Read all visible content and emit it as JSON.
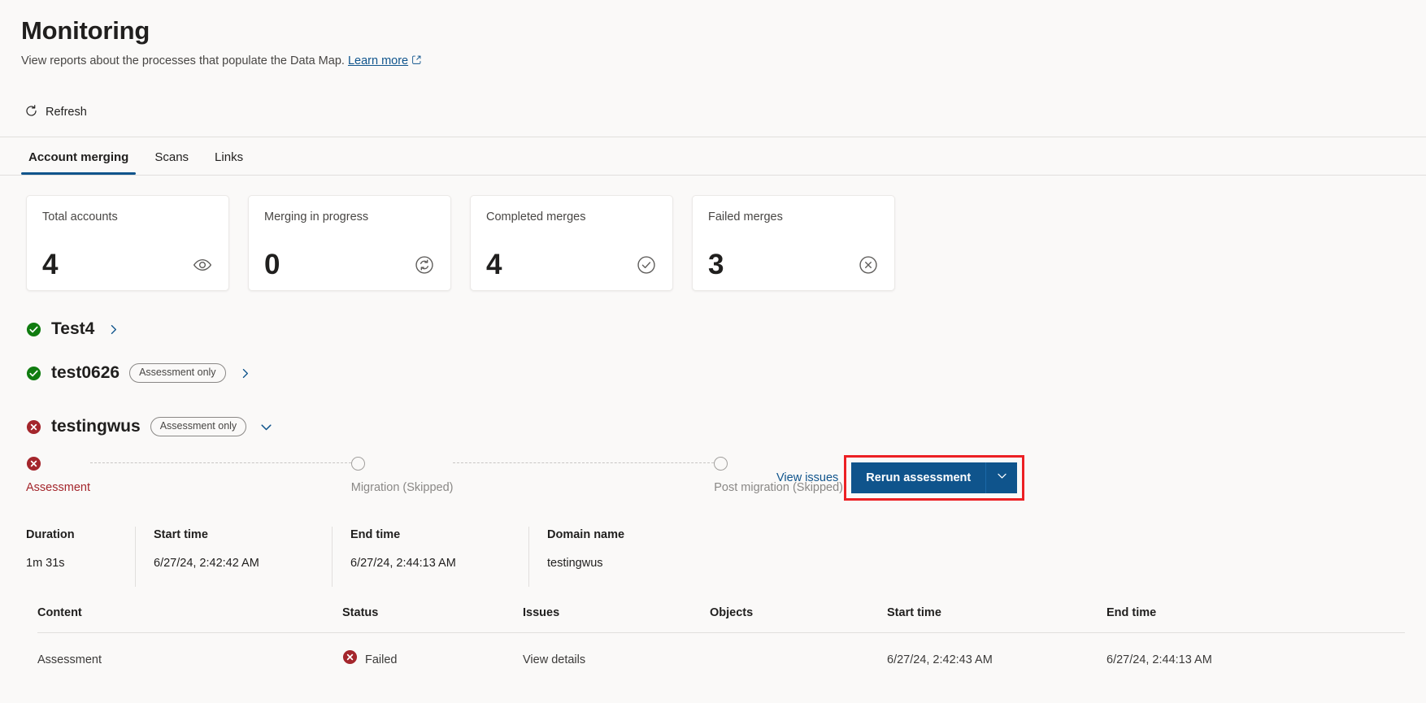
{
  "header": {
    "title": "Monitoring",
    "subtitle": "View reports about the processes that populate the Data Map.",
    "learn_more": "Learn more",
    "learn_more_icon": "external-link-icon"
  },
  "command_bar": {
    "refresh_label": "Refresh",
    "refresh_icon": "refresh-icon"
  },
  "tabs": [
    {
      "label": "Account merging",
      "active": true
    },
    {
      "label": "Scans",
      "active": false
    },
    {
      "label": "Links",
      "active": false
    }
  ],
  "stat_cards": [
    {
      "label": "Total accounts",
      "value": "4",
      "icon": "eye-icon"
    },
    {
      "label": "Merging in progress",
      "value": "0",
      "icon": "sync-icon"
    },
    {
      "label": "Completed merges",
      "value": "4",
      "icon": "check-circle-icon"
    },
    {
      "label": "Failed merges",
      "value": "3",
      "icon": "error-circle-icon"
    }
  ],
  "domains": [
    {
      "name": "Test4",
      "status": "success",
      "pill": "",
      "chevron": "chevron-right-icon"
    },
    {
      "name": "test0626",
      "status": "success",
      "pill": "Assessment only",
      "chevron": "chevron-right-icon"
    },
    {
      "name": "testingwus",
      "status": "error",
      "pill": "Assessment only",
      "chevron": "chevron-down-icon"
    }
  ],
  "stepper": {
    "steps": [
      {
        "label": "Assessment",
        "state": "failed"
      },
      {
        "label": "Migration (Skipped)",
        "state": "skipped"
      },
      {
        "label": "Post migration (Skipped)",
        "state": "skipped"
      }
    ]
  },
  "actions": {
    "view_issues": "View issues",
    "rerun_assessment": "Rerun assessment",
    "caret_icon": "chevron-down-icon",
    "highlight_color": "#ec2024",
    "primary_color": "#0f548c"
  },
  "meta": [
    {
      "label": "Duration",
      "value": "1m 31s"
    },
    {
      "label": "Start time",
      "value": "6/27/24, 2:42:42 AM"
    },
    {
      "label": "End time",
      "value": "6/27/24, 2:44:13 AM"
    },
    {
      "label": "Domain name",
      "value": "testingwus"
    }
  ],
  "table": {
    "columns": [
      "Content",
      "Status",
      "Issues",
      "Objects",
      "Start time",
      "End time"
    ],
    "rows": [
      {
        "content": "Assessment",
        "status": "Failed",
        "status_icon": "error-circle-icon",
        "issues": "View details",
        "objects": "",
        "start_time": "6/27/24, 2:42:43 AM",
        "end_time": "6/27/24, 2:44:13 AM"
      }
    ]
  },
  "colors": {
    "accent": "#0f548c",
    "success": "#107c10",
    "error": "#a4262c",
    "highlight": "#ec2024"
  }
}
